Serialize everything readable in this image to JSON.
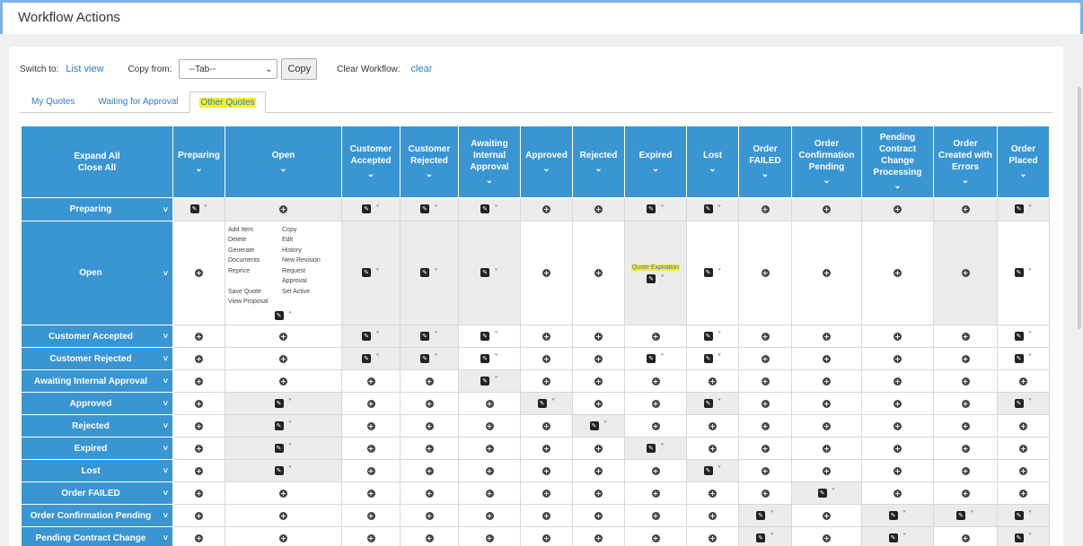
{
  "page": {
    "title": "Workflow Actions"
  },
  "toolbar": {
    "switch_label": "Switch to:",
    "switch_link": "List view",
    "copy_from_label": "Copy from:",
    "copy_select_value": "--Tab--",
    "copy_button": "Copy",
    "clear_label": "Clear Workflow:",
    "clear_link": "clear"
  },
  "tabs": [
    {
      "label": "My Quotes"
    },
    {
      "label": "Waiting for Approval"
    },
    {
      "label": "Other Quotes",
      "active": true
    }
  ],
  "table": {
    "expand_all": "Expand All",
    "close_all": "Close All",
    "columns": [
      "Preparing",
      "Open",
      "Customer Accepted",
      "Customer Rejected",
      "Awaiting Internal Approval",
      "Approved",
      "Rejected",
      "Expired",
      "Lost",
      "Order FAILED",
      "Order Confirmation Pending",
      "Pending Contract Change Processing",
      "Order Created with Errors",
      "Order Placed"
    ],
    "rows": [
      {
        "label": "Preparing",
        "cells": "EPEEEPPEEPPPPE",
        "grey": "EPEEEPPEEPPPPE"
      },
      {
        "label": "Open",
        "cells": "PXEEEPPQEPPPPE",
        "grey": "_XGGG__G____G"
      },
      {
        "label": "Customer Accepted",
        "cells": "PPEEEPPPEPPPPE",
        "grey": "__GG________"
      },
      {
        "label": "Customer Rejected",
        "cells": "PPEEEPPEEPPPPE",
        "grey": "__GG________"
      },
      {
        "label": "Awaiting Internal Approval",
        "cells": "PPPPEPPPPPPPPP",
        "grey": "____G_________"
      },
      {
        "label": "Approved",
        "cells": "PEPPPEPPEPPPPE",
        "grey": "_G___G__G____G"
      },
      {
        "label": "Rejected",
        "cells": "PEPPPPEPPPPPPP",
        "grey": "_G____G_______"
      },
      {
        "label": "Expired",
        "cells": "PEPPPPPEPPPPPP",
        "grey": "_G_____G______"
      },
      {
        "label": "Lost",
        "cells": "PEPPPPPPEPPPPP",
        "grey": "_G______G_____"
      },
      {
        "label": "Order FAILED",
        "cells": "PPPPPPPPPPEPPP",
        "grey": "__________G___"
      },
      {
        "label": "Order Confirmation Pending",
        "cells": "PPPPPPPPPEPEEE",
        "grey": "_________G_GGG"
      },
      {
        "label": "Pending Contract Change",
        "cells": "PPPPPPPPPEPEPE",
        "grey": "_________G_G_G"
      }
    ],
    "open_actions": {
      "col1": [
        "Add Item",
        "Delete",
        "Generate",
        "Documents",
        "Reprice",
        "",
        "Save Quote",
        "View Proposal"
      ],
      "col2": [
        "Copy",
        "Edit",
        "History",
        "New Revision",
        "Request",
        "Approval",
        "Set Active",
        ""
      ]
    },
    "quote_expiration": "Quote Expiration"
  },
  "colors": {
    "header_blue": "#3a95d3",
    "link_blue": "#2e7bc4",
    "highlight": "#f7ee2a"
  }
}
